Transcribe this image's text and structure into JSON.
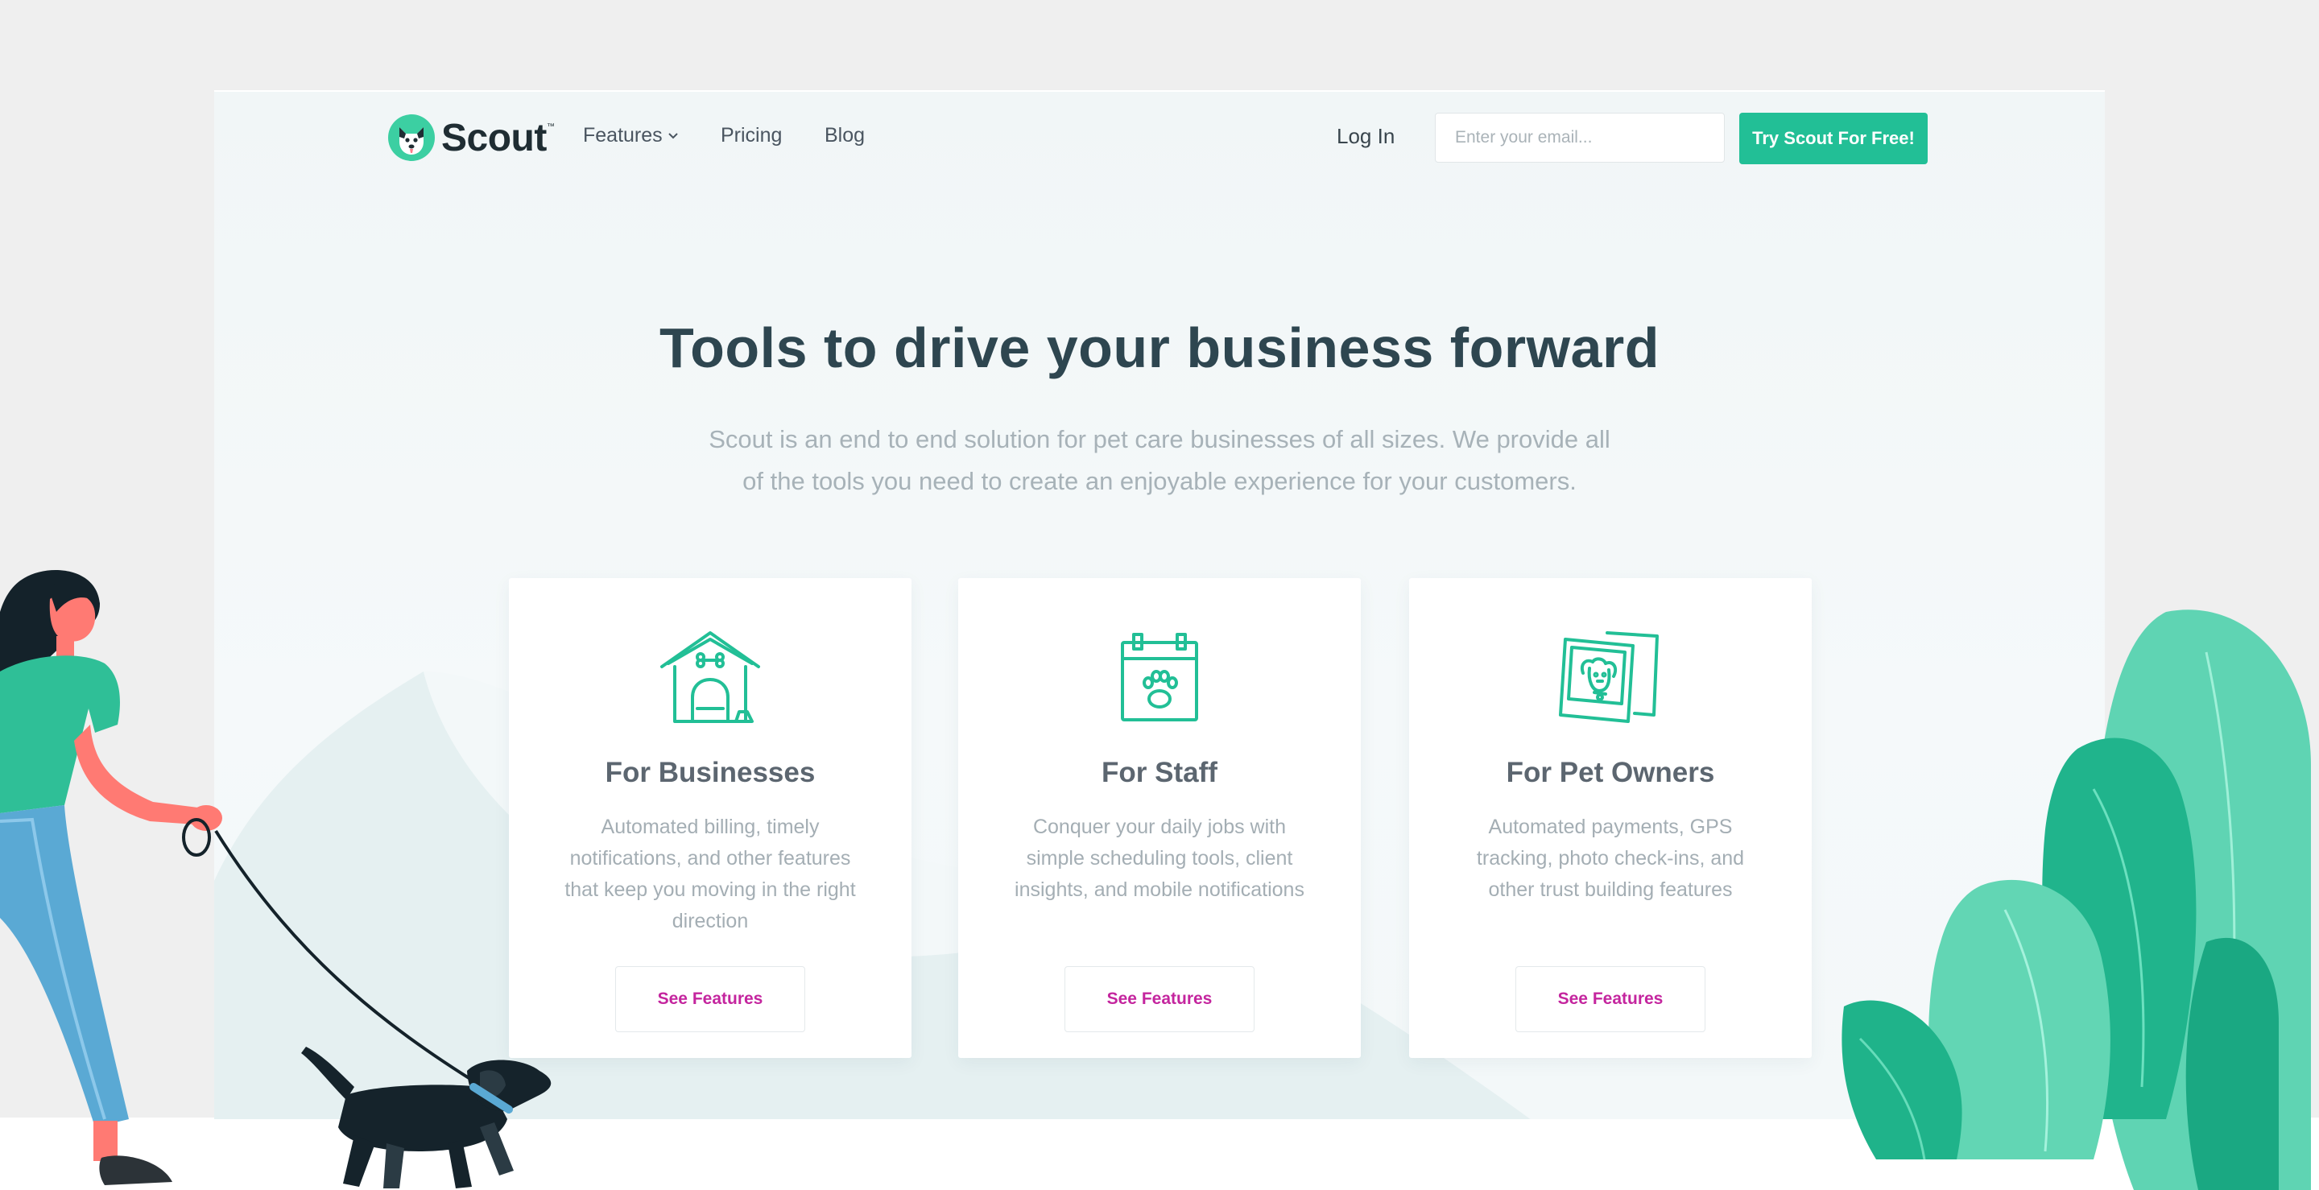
{
  "brand": {
    "name": "Scout",
    "trademark": "™"
  },
  "nav": {
    "features_label": "Features",
    "pricing_label": "Pricing",
    "blog_label": "Blog",
    "login_label": "Log In",
    "email_placeholder": "Enter your email...",
    "cta_label": "Try Scout For Free!"
  },
  "hero": {
    "title": "Tools to drive your business forward",
    "subtitle_line1": "Scout is an end to end solution for pet care businesses of all sizes. We provide all",
    "subtitle_line2": "of the tools you need to create an enjoyable experience for your customers."
  },
  "cards": [
    {
      "icon": "dog-house-icon",
      "title": "For Businesses",
      "desc_lines": [
        "Automated billing, timely",
        "notifications, and other features",
        "that keep you moving in the right",
        "direction"
      ],
      "button": "See Features"
    },
    {
      "icon": "calendar-paw-icon",
      "title": "For Staff",
      "desc_lines": [
        "Conquer your daily jobs with",
        "simple scheduling tools, client",
        "insights, and mobile notifications"
      ],
      "button": "See Features"
    },
    {
      "icon": "dog-photo-icon",
      "title": "For Pet Owners",
      "desc_lines": [
        "Automated payments, GPS",
        "tracking, photo check-ins, and",
        "other trust building features"
      ],
      "button": "See Features"
    }
  ],
  "colors": {
    "accent": "#22bf96",
    "link": "#c4259e",
    "title": "#2e4650",
    "muted": "#a7b2b8",
    "background": "#efefef"
  }
}
